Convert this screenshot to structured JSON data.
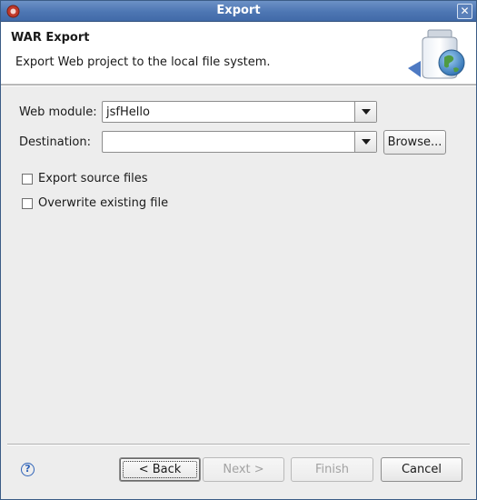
{
  "window": {
    "title": "Export",
    "close_glyph": "✕"
  },
  "banner": {
    "title": "WAR Export",
    "description": "Export Web project to the local file system.",
    "image_icon": "jar-globe-export-icon"
  },
  "form": {
    "web_module_label": "Web module:",
    "web_module_value": "jsfHello",
    "destination_label": "Destination:",
    "destination_value": "",
    "browse_label": "Browse...",
    "export_source_label": "Export source files",
    "export_source_checked": false,
    "overwrite_label": "Overwrite existing file",
    "overwrite_checked": false
  },
  "footer": {
    "help_glyph": "?",
    "back_label": "< Back",
    "next_label": "Next >",
    "finish_label": "Finish",
    "cancel_label": "Cancel"
  },
  "colors": {
    "titlebar": "#4d76b3",
    "dialog_bg": "#ededed",
    "disabled_text": "#a2a2a2"
  }
}
